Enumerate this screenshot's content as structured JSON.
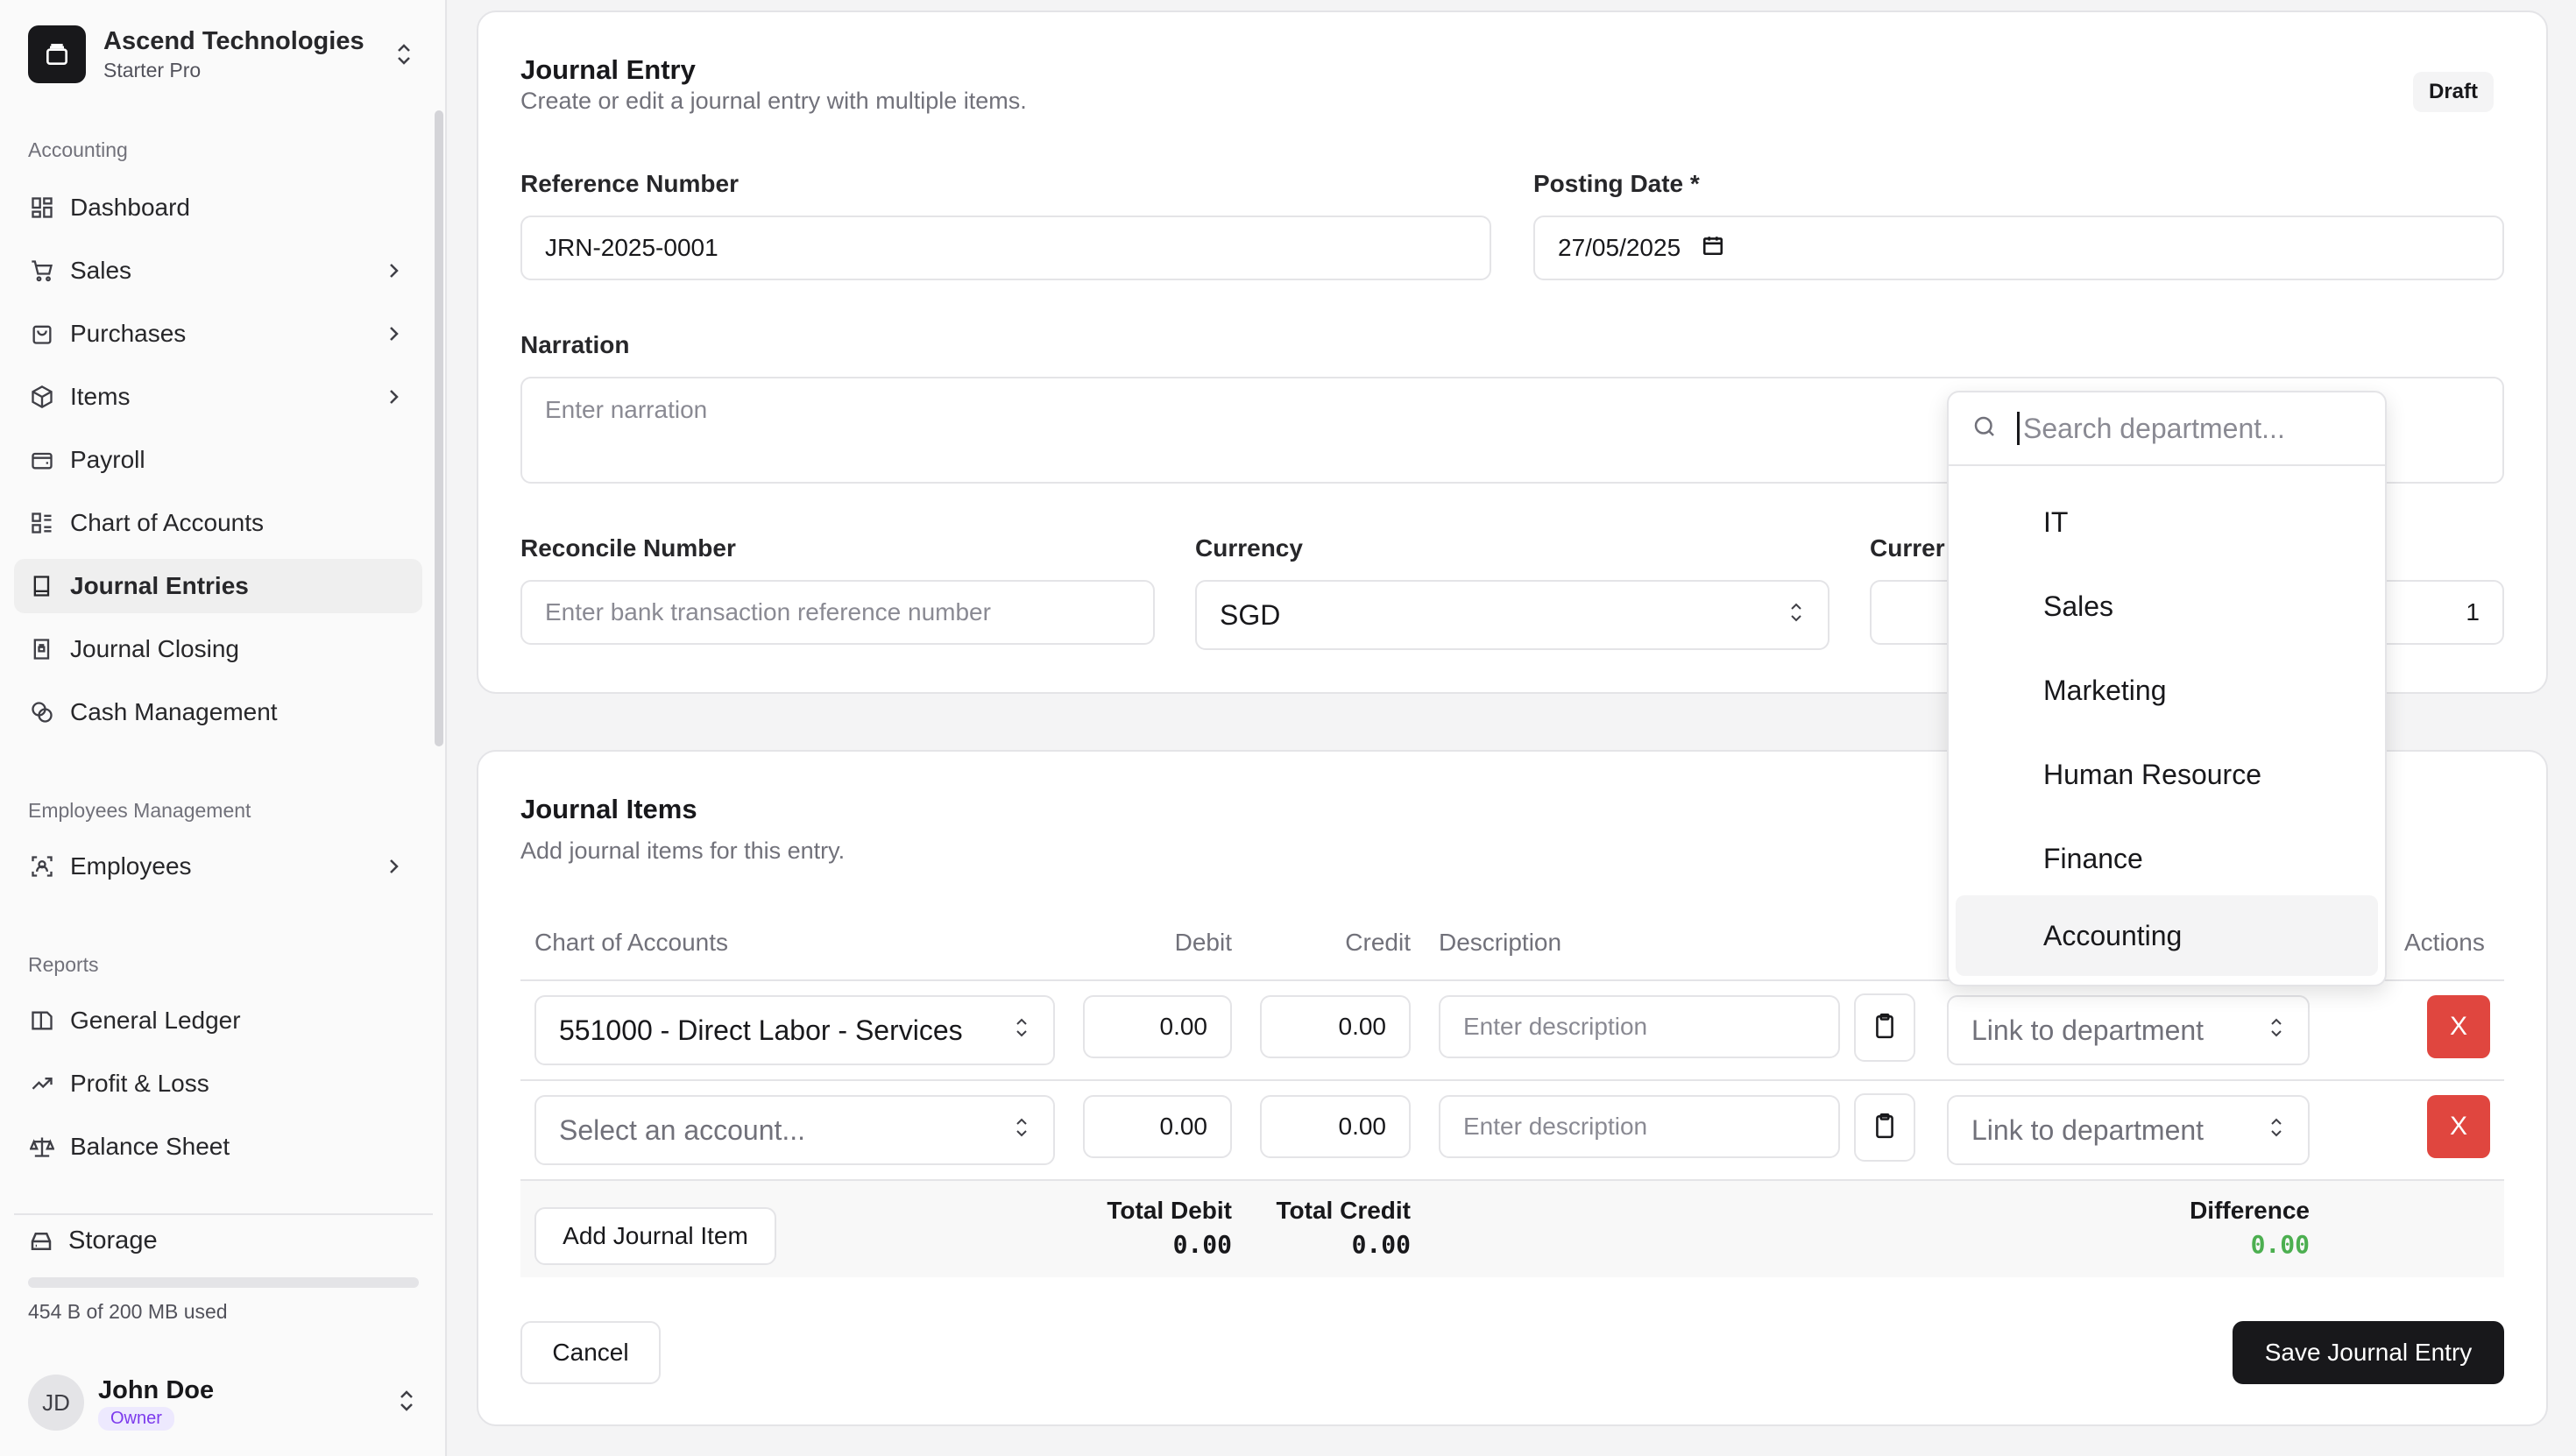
{
  "org": {
    "name": "Ascend Technologies",
    "plan": "Starter Pro"
  },
  "sidebar": {
    "group_accounting": "Accounting",
    "items": [
      {
        "label": "Dashboard"
      },
      {
        "label": "Sales"
      },
      {
        "label": "Purchases"
      },
      {
        "label": "Items"
      },
      {
        "label": "Payroll"
      },
      {
        "label": "Chart of Accounts"
      },
      {
        "label": "Journal Entries"
      },
      {
        "label": "Journal Closing"
      },
      {
        "label": "Cash Management"
      }
    ],
    "group_employees": "Employees Management",
    "employees": "Employees",
    "group_reports": "Reports",
    "reports": [
      {
        "label": "General Ledger"
      },
      {
        "label": "Profit & Loss"
      },
      {
        "label": "Balance Sheet"
      }
    ],
    "storage": {
      "label": "Storage",
      "used_text": "454 B of 200 MB used",
      "used_fraction": 2e-06
    }
  },
  "user": {
    "name": "John Doe",
    "initials": "JD",
    "role": "Owner"
  },
  "entry": {
    "title": "Journal Entry",
    "subtitle": "Create or edit a journal entry with multiple items.",
    "status": "Draft",
    "reference_label": "Reference Number",
    "reference_value": "JRN-2025-0001",
    "posting_label": "Posting Date *",
    "posting_value": "27/05/2025",
    "narration_label": "Narration",
    "narration_placeholder": "Enter narration",
    "reconcile_label": "Reconcile Number",
    "reconcile_placeholder": "Enter bank transaction reference number",
    "currency_label": "Currency",
    "currency_value": "SGD",
    "rate_label": "Currer",
    "rate_value": "1"
  },
  "items": {
    "title": "Journal Items",
    "subtitle": "Add journal items for this entry.",
    "headers": {
      "account": "Chart of Accounts",
      "debit": "Debit",
      "credit": "Credit",
      "description": "Description",
      "actions": "Actions"
    },
    "rows": [
      {
        "account": "551000 - Direct Labor - Services",
        "debit": "0.00",
        "credit": "0.00",
        "description_placeholder": "Enter description",
        "department": "Link to department",
        "remove": "X"
      },
      {
        "account": "Select an account...",
        "debit": "0.00",
        "credit": "0.00",
        "description_placeholder": "Enter description",
        "department": "Link to department",
        "remove": "X"
      }
    ],
    "add_label": "Add Journal Item",
    "total_debit_label": "Total Debit",
    "total_debit": "0.00",
    "total_credit_label": "Total Credit",
    "total_credit": "0.00",
    "difference_label": "Difference",
    "difference": "0.00"
  },
  "actions": {
    "cancel": "Cancel",
    "save": "Save Journal Entry"
  },
  "department_dropdown": {
    "placeholder": "Search department...",
    "options": [
      "IT",
      "Sales",
      "Marketing",
      "Human Resource",
      "Finance",
      "Accounting"
    ],
    "highlighted": "Accounting"
  },
  "colors": {
    "danger": "#e0463f",
    "success": "#4caf50",
    "primary": "#18181b",
    "role_badge": "#7c3aed"
  }
}
